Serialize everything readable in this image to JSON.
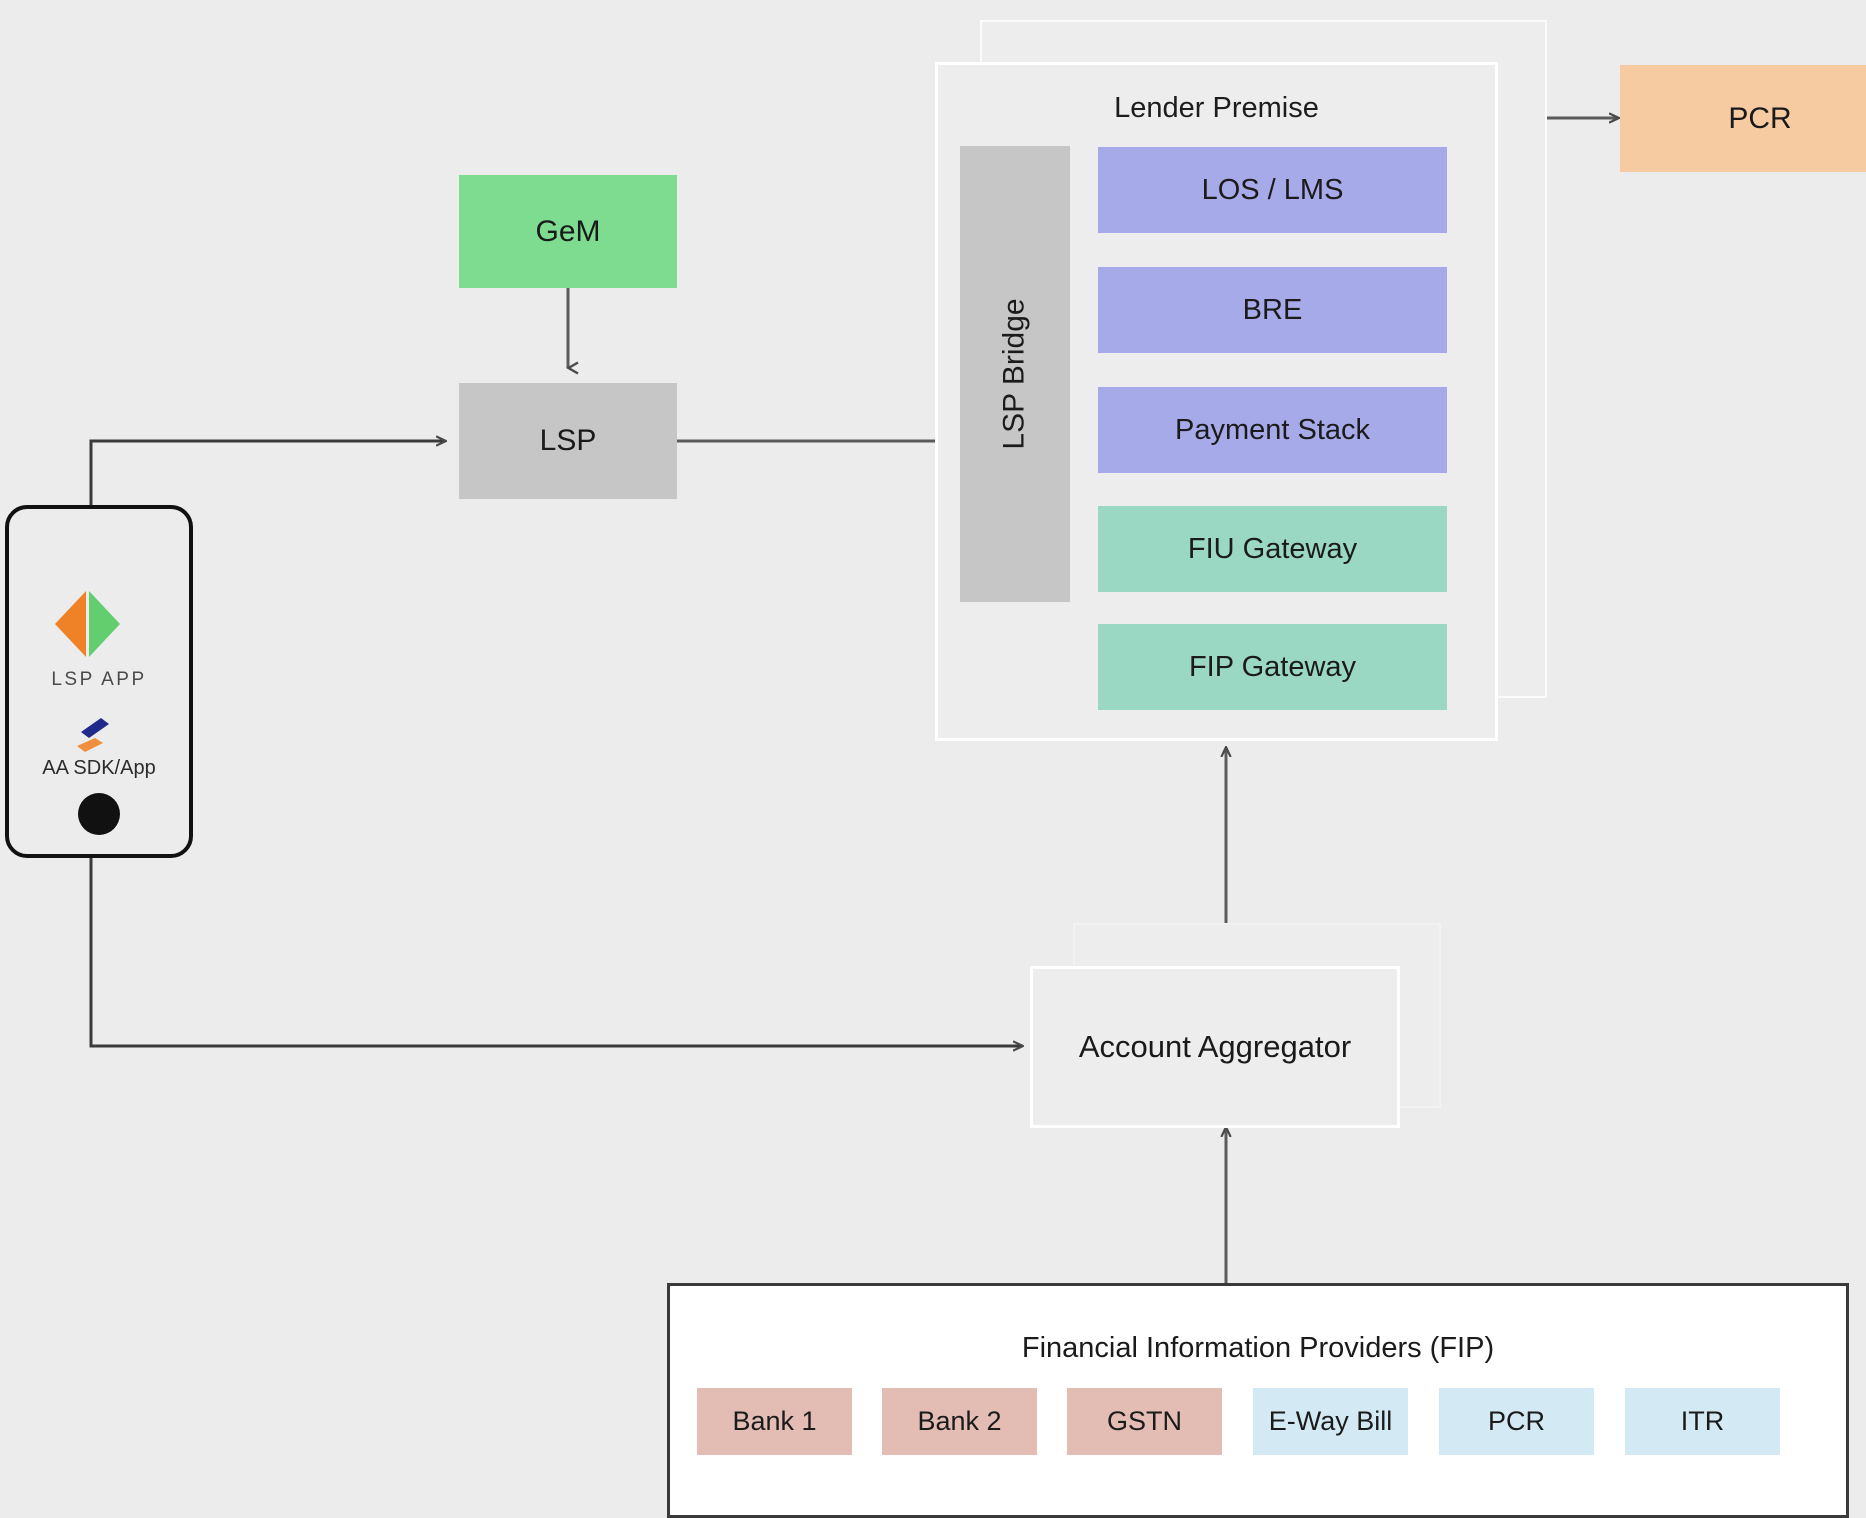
{
  "diagram": {
    "background_color": "#ececec",
    "nodes": {
      "gem": {
        "label": "GeM",
        "color": "#7ddc8f"
      },
      "lsp": {
        "label": "LSP",
        "color": "#c6c6c6"
      },
      "lsp_bridge": {
        "label": "LSP Bridge",
        "color": "#c6c6c6"
      },
      "pcr": {
        "label": "PCR",
        "color": "#f7cba2"
      },
      "account_aggregator": {
        "label": "Account Aggregator"
      }
    },
    "lender_premise": {
      "title": "Lender Premise",
      "services": [
        {
          "label": "LOS / LMS",
          "color": "#a7aae8",
          "kind": "purple"
        },
        {
          "label": "BRE",
          "color": "#a7aae8",
          "kind": "purple"
        },
        {
          "label": "Payment Stack",
          "color": "#a7aae8",
          "kind": "purple"
        },
        {
          "label": "FIU Gateway",
          "color": "#9ad8c3",
          "kind": "teal"
        },
        {
          "label": "FIP Gateway",
          "color": "#9ad8c3",
          "kind": "teal"
        }
      ]
    },
    "phone": {
      "lsp_app_label": "LSP APP",
      "aa_sdk_label": "AA SDK/App",
      "lsp_app_icon_colors": {
        "left": "#ef8127",
        "right": "#63ce6e"
      },
      "aa_icon_colors": {
        "top": "#1f2a8a",
        "bottom": "#ef8f3f"
      }
    },
    "fip": {
      "title": "Financial Information Providers (FIP)",
      "providers": [
        {
          "label": "Bank 1",
          "kind": "rose",
          "color": "#e3bcb4"
        },
        {
          "label": "Bank 2",
          "kind": "rose",
          "color": "#e3bcb4"
        },
        {
          "label": "GSTN",
          "kind": "rose",
          "color": "#e3bcb4"
        },
        {
          "label": "E-Way Bill",
          "kind": "blue",
          "color": "#d3eaf4"
        },
        {
          "label": "PCR",
          "kind": "blue",
          "color": "#d3eaf4"
        },
        {
          "label": "ITR",
          "kind": "blue",
          "color": "#d3eaf4"
        }
      ]
    },
    "connector_color": "#5b5b5b"
  }
}
